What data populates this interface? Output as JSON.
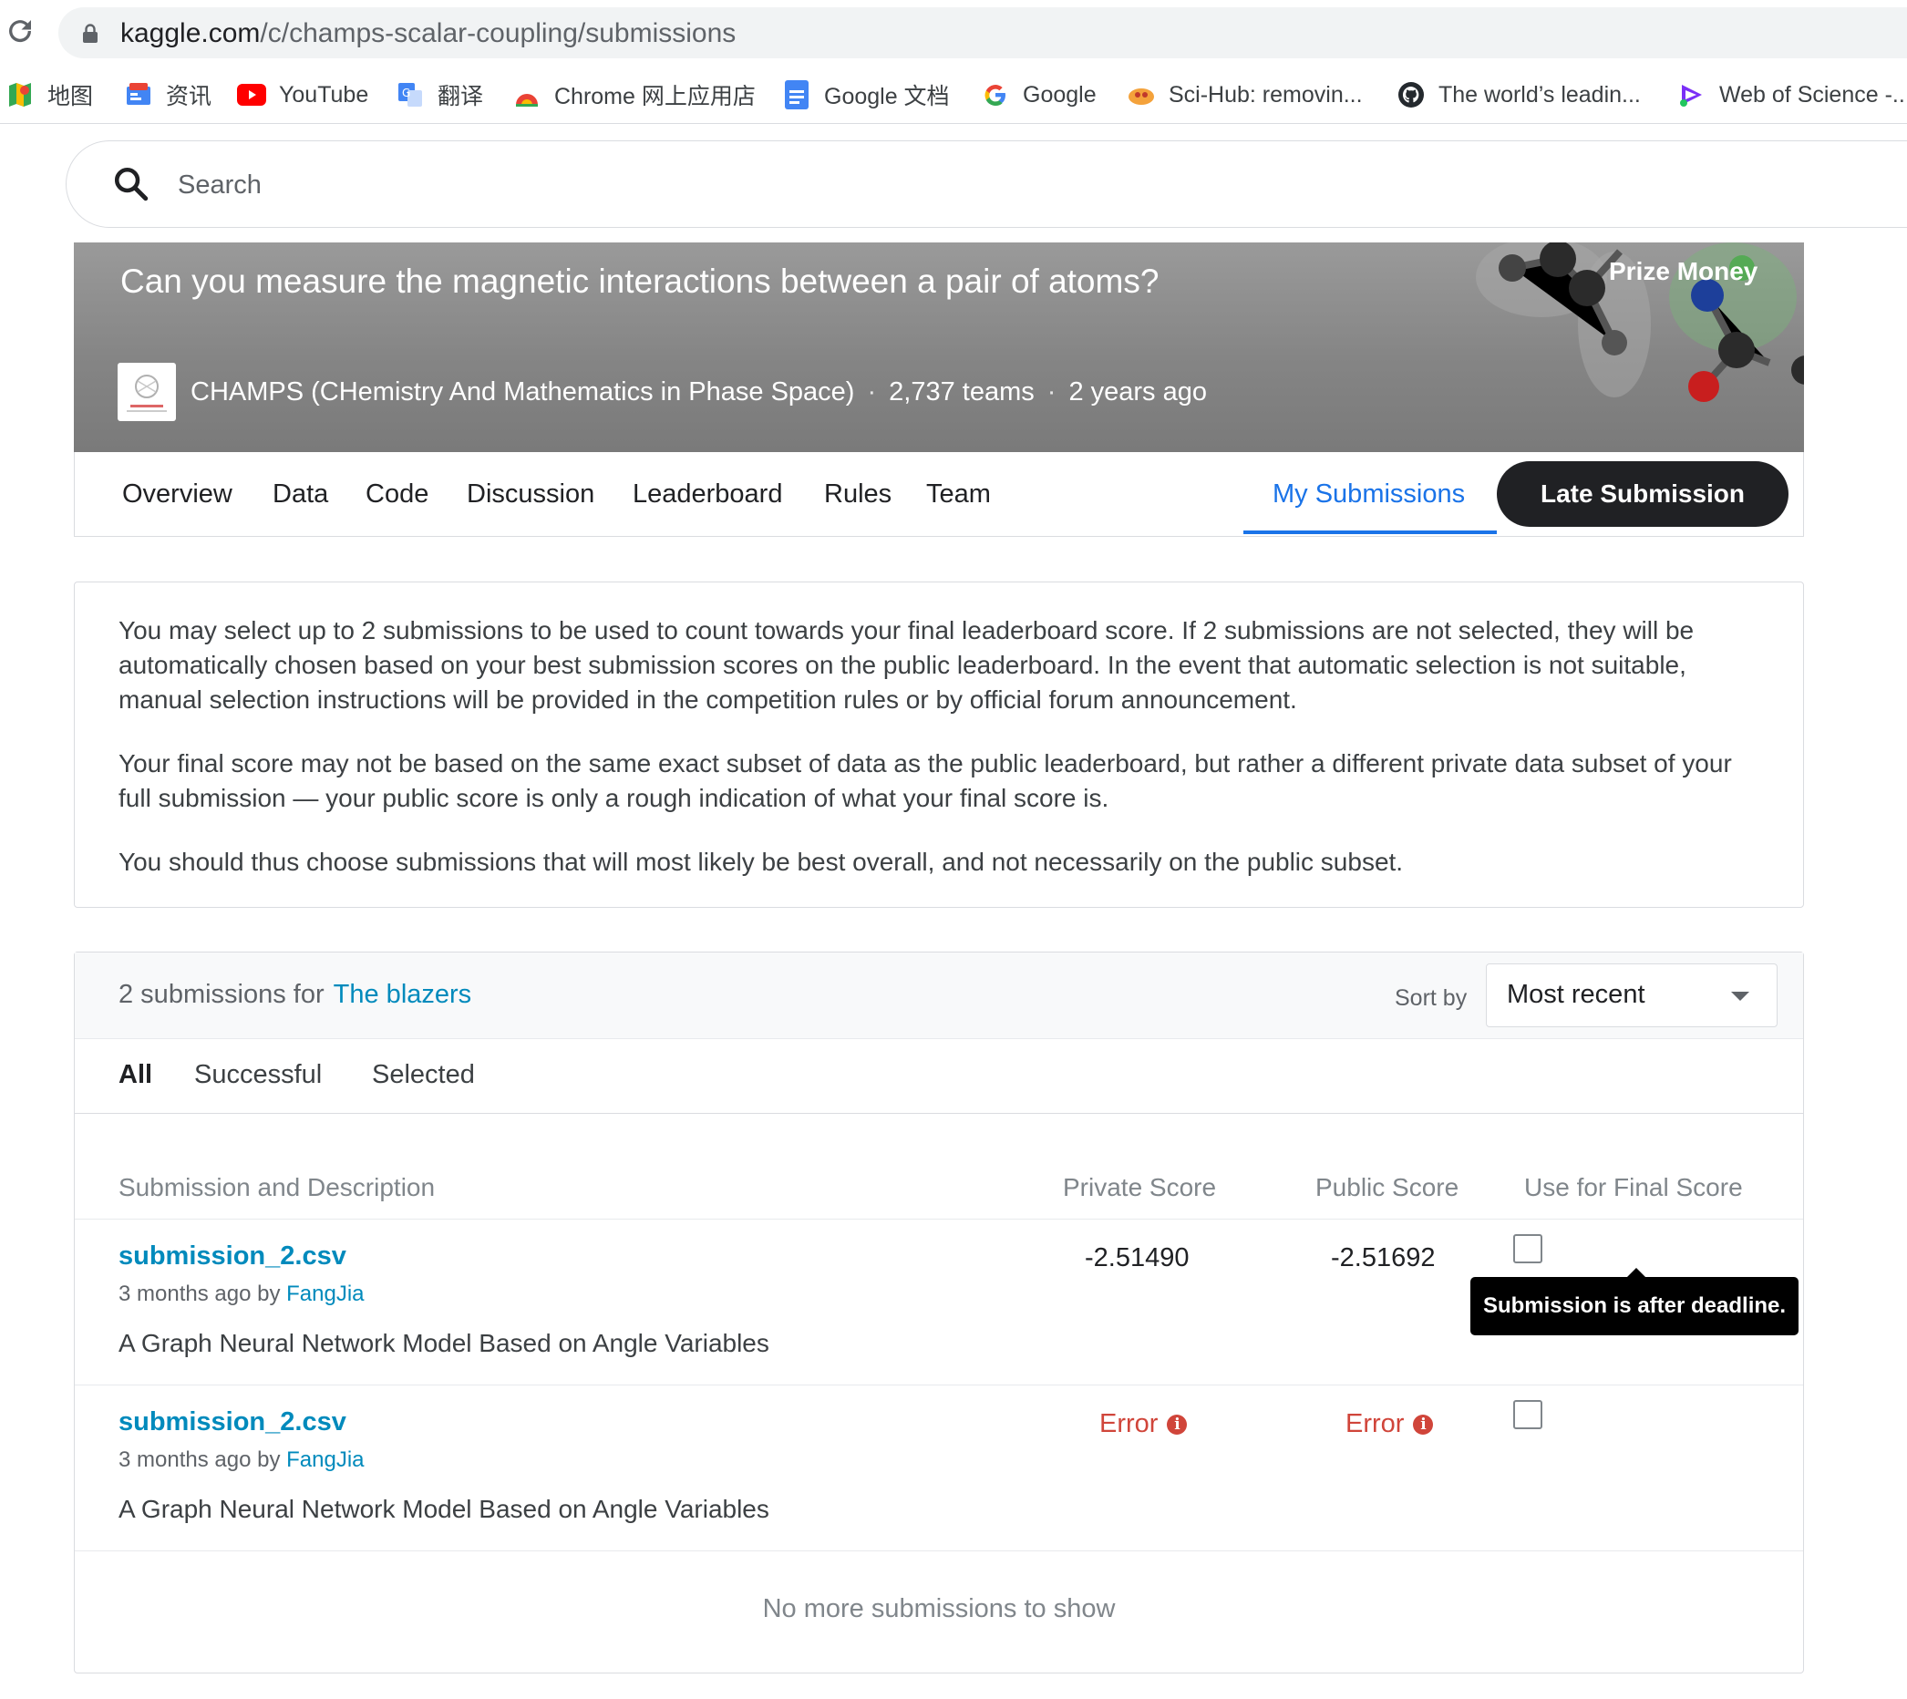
{
  "browser": {
    "url_host": "kaggle.com",
    "url_path": "/c/champs-scalar-coupling/submissions",
    "bookmarks": [
      {
        "label": "地图",
        "icon": "maps-icon"
      },
      {
        "label": "资讯",
        "icon": "news-icon"
      },
      {
        "label": "YouTube",
        "icon": "youtube-icon"
      },
      {
        "label": "翻译",
        "icon": "translate-icon"
      },
      {
        "label": "Chrome 网上应用店",
        "icon": "chrome-webstore-icon"
      },
      {
        "label": "Google 文档",
        "icon": "google-docs-icon"
      },
      {
        "label": "Google",
        "icon": "google-icon"
      },
      {
        "label": "Sci-Hub: removin...",
        "icon": "scihub-icon"
      },
      {
        "label": "The world’s leadin...",
        "icon": "github-icon"
      },
      {
        "label": "Web of Science -...",
        "icon": "web-of-science-icon"
      }
    ]
  },
  "search": {
    "placeholder": "Search"
  },
  "competition": {
    "subtitle": "Can you measure the magnetic interactions between a pair of atoms?",
    "host": "CHAMPS (CHemistry And Mathematics in Phase Space)",
    "teams": "2,737 teams",
    "age": "2 years ago",
    "prize": "Prize Money",
    "separator": "·"
  },
  "tabs": {
    "items": [
      "Overview",
      "Data",
      "Code",
      "Discussion",
      "Leaderboard",
      "Rules",
      "Team"
    ],
    "my_submissions": "My Submissions",
    "late_submission": "Late Submission"
  },
  "info": {
    "p1": "You may select up to 2 submissions to be used to count towards your final leaderboard score. If 2 submissions are not selected, they will be automatically chosen based on your best submission scores on the public leaderboard. In the event that automatic selection is not suitable, manual selection instructions will be provided in the competition rules or by official forum announcement.",
    "p2": "Your final score may not be based on the same exact subset of data as the public leaderboard, but rather a different private data subset of your full submission — your public score is only a rough indication of what your final score is.",
    "p3": "You should thus choose submissions that will most likely be best overall, and not necessarily on the public subset."
  },
  "submissions": {
    "count_prefix": "2 submissions for",
    "team": "The blazers",
    "sort_label": "Sort by",
    "sort_value": "Most recent",
    "filters": [
      "All",
      "Successful",
      "Selected"
    ],
    "columns": {
      "description": "Submission and Description",
      "private": "Private Score",
      "public": "Public Score",
      "final": "Use for Final Score"
    },
    "rows": [
      {
        "file": "submission_2.csv",
        "meta_prefix": "3 months ago by",
        "author": "FangJia",
        "description": "A Graph Neural Network Model Based on Angle Variables",
        "private": "-2.51490",
        "public": "-2.51692"
      },
      {
        "file": "submission_2.csv",
        "meta_prefix": "3 months ago by",
        "author": "FangJia",
        "description": "A Graph Neural Network Model Based on Angle Variables",
        "private": "Error",
        "public": "Error"
      }
    ],
    "tooltip": "Submission is after deadline.",
    "no_more": "No more submissions to show"
  }
}
